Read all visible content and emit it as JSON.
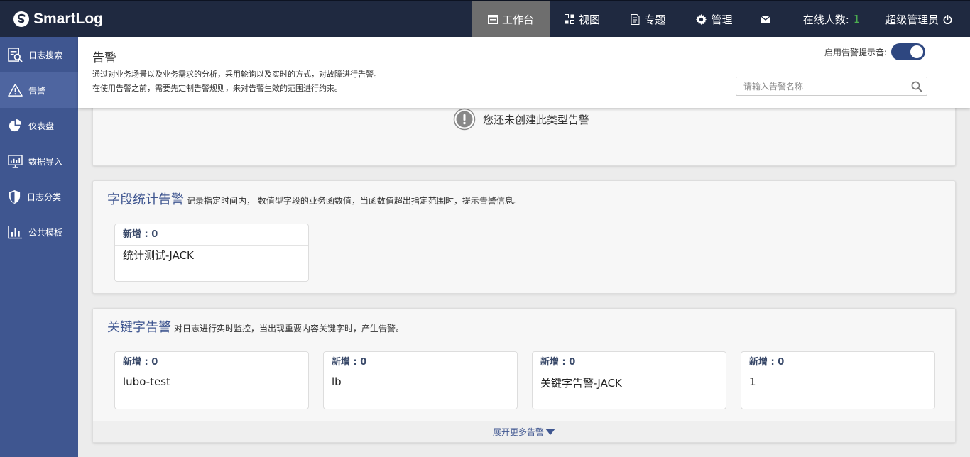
{
  "app": {
    "logo": "SmartLog"
  },
  "topnav": {
    "workbench": "工作台",
    "views": "视图",
    "topics": "专题",
    "manage": "管理",
    "online_label": "在线人数:",
    "online_count": "1",
    "user": "超级管理员"
  },
  "sidebar": {
    "items": [
      {
        "label": "日志搜索",
        "icon": "log-search-icon"
      },
      {
        "label": "告警",
        "icon": "warning-icon"
      },
      {
        "label": "仪表盘",
        "icon": "pie-chart-icon"
      },
      {
        "label": "数据导入",
        "icon": "data-import-icon"
      },
      {
        "label": "日志分类",
        "icon": "shield-icon"
      },
      {
        "label": "公共模板",
        "icon": "bar-chart-icon"
      }
    ]
  },
  "header": {
    "title": "告警",
    "desc1": "通过对业务场景以及业务需求的分析，采用轮询以及实时的方式，对故障进行告警。",
    "desc2": "在使用告警之前，需要先定制告警规则，来对告警生效的范围进行约束。",
    "toggle_label": "启用告警提示音:",
    "toggle_on": true,
    "search_placeholder": "请输入告警名称"
  },
  "empty": {
    "message": "您还未创建此类型告警"
  },
  "field_stat": {
    "title": "字段统计告警",
    "desc": "记录指定时间内， 数值型字段的业务函数值，当函数值超出指定范围时，提示告警信息。",
    "cards": [
      {
        "new": "新增 : 0",
        "name": "统计测试-JACK"
      }
    ]
  },
  "keyword": {
    "title": "关键字告警",
    "desc": "对日志进行实时监控，当出现重要内容关键字时，产生告警。",
    "cards": [
      {
        "new": "新增 : 0",
        "name": "lubo-test"
      },
      {
        "new": "新增 : 0",
        "name": "lb"
      },
      {
        "new": "新增 : 0",
        "name": "关键字告警-JACK"
      },
      {
        "new": "新增 : 0",
        "name": "1"
      }
    ],
    "more": "展开更多告警"
  },
  "colors": {
    "topbar": "#1f2940",
    "sidebar": "#3f5690",
    "accent": "#3f5690",
    "online": "#4caf50"
  }
}
